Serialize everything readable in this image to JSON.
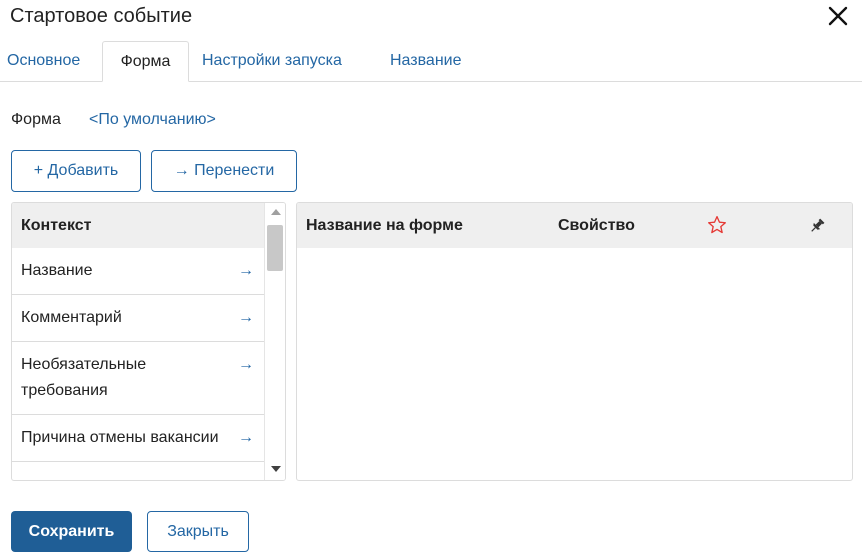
{
  "dialog": {
    "title": "Стартовое событие"
  },
  "tabs": [
    {
      "label": "Основное",
      "active": false
    },
    {
      "label": "Форма",
      "active": true
    },
    {
      "label": "Настройки запуска",
      "active": false
    },
    {
      "label": "Название",
      "active": false
    }
  ],
  "form": {
    "label": "Форма",
    "value_link": "<По умолчанию>"
  },
  "toolbar": {
    "add_label": "+ Добавить",
    "move_label": "→ Перенести"
  },
  "context_list": {
    "header": "Контекст",
    "items": [
      {
        "label": "Название",
        "arrow": "→"
      },
      {
        "label": "Комментарий",
        "arrow": "→"
      },
      {
        "label": "Необязательные требования",
        "arrow": "→"
      },
      {
        "label": "Причина отмены вакансии",
        "arrow": "→"
      }
    ]
  },
  "form_fields_table": {
    "columns": {
      "name": "Название на форме",
      "property": "Свойство"
    },
    "icons": {
      "favorite": "star-icon",
      "pin": "pin-icon"
    },
    "rows": []
  },
  "footer": {
    "save_label": "Сохранить",
    "close_label": "Закрыть"
  },
  "colors": {
    "accent": "#2467a4",
    "primary_button": "#1f5e96",
    "star": "#e53935",
    "header_bg": "#efefef",
    "border": "#dcdcdc"
  }
}
